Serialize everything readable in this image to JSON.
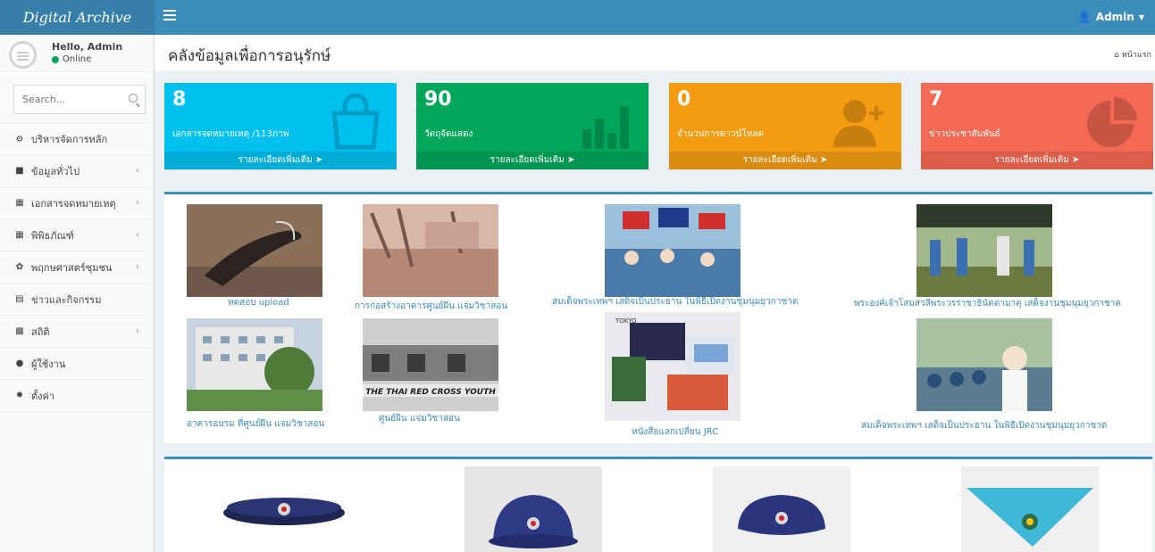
{
  "app": {
    "logo": "Digital Archive"
  },
  "header": {
    "user_label": "Admin"
  },
  "sidebar": {
    "greeting": "Hello, Admin",
    "status": "Online",
    "search_placeholder": "Search...",
    "items": [
      {
        "label": "บริหารจัดการหลัก",
        "icon": "dashboard-icon",
        "has_caret": false
      },
      {
        "label": "ข้อมูลทั่วไป",
        "icon": "book-icon",
        "has_caret": true
      },
      {
        "label": "เอกสารจดหมายเหตุ",
        "icon": "grid-icon",
        "has_caret": true
      },
      {
        "label": "พิพิธภัณฑ์",
        "icon": "grid-icon",
        "has_caret": true
      },
      {
        "label": "พฤกษศาสตร์ชุมชน",
        "icon": "leaf-icon",
        "has_caret": true
      },
      {
        "label": "ข่าวและกิจกรรม",
        "icon": "calendar-icon",
        "has_caret": false
      },
      {
        "label": "สถิติ",
        "icon": "bar-chart-icon",
        "has_caret": true
      },
      {
        "label": "ผู้ใช้งาน",
        "icon": "user-icon",
        "has_caret": false
      },
      {
        "label": "ตั้งค่า",
        "icon": "gear-icon",
        "has_caret": false
      }
    ]
  },
  "page": {
    "title": "คลังข้อมูลเพื่อการอนุรักษ์",
    "breadcrumb": "หน้าแรก"
  },
  "stats": [
    {
      "value": "8",
      "label": "เอกสารจดหมายเหตุ /113ภาพ",
      "link": "รายละเอียดเพิ่มเติม",
      "color": "#00c0ef",
      "icon": "shopping-bag-icon"
    },
    {
      "value": "90",
      "label": "วัตถุจัดแสดง",
      "link": "รายละเอียดเพิ่มเติม",
      "color": "#00a65a",
      "icon": "bar-chart-icon"
    },
    {
      "value": "0",
      "label": "จำนวนการดาวน์โหลด",
      "link": "รายละเอียดเพิ่มเติม",
      "color": "#f39c12",
      "icon": "user-add-icon"
    },
    {
      "value": "7",
      "label": "ข่าวประชาสัมพันธ์",
      "link": "รายละเอียดเพิ่มเติม",
      "color": "#f56954",
      "icon": "pie-chart-icon"
    }
  ],
  "archive_images": [
    {
      "caption": "ทดสอบ upload"
    },
    {
      "caption": "การก่อสร้างอาคารศูนย์ฝึน แจ่มวิชาสอน"
    },
    {
      "caption": "สมเด็จพระเทพฯ เสด็จเป็นประธาน ในพิธีเปิดงานชุมนุมยุวกาชาด"
    },
    {
      "caption": "พระองค์เจ้าโสมสวลีพระวรราชาธินัดดามาตุ เสด็จงานชุมนุมยุวกาชาด"
    },
    {
      "caption": "อาคารอบรม ที่ศูนย์ฝึน แจ่มวิชาสอน"
    },
    {
      "caption": "ศูนย์ฝึน แจ่มวิชาสอน"
    },
    {
      "caption": "หนังสือแลกเปลี่ยน JRC"
    },
    {
      "caption": "สมเด็จพระเทพฯ เสด็จเป็นประธาน ในพิธีเปิดงานชุมนุมยุวกาชาด"
    }
  ],
  "photo_signage": {
    "banner_text": "THE THAI RED CROSS YOUTH",
    "card_text": "TOKYO"
  },
  "museum_items": [
    {},
    {},
    {},
    {}
  ]
}
